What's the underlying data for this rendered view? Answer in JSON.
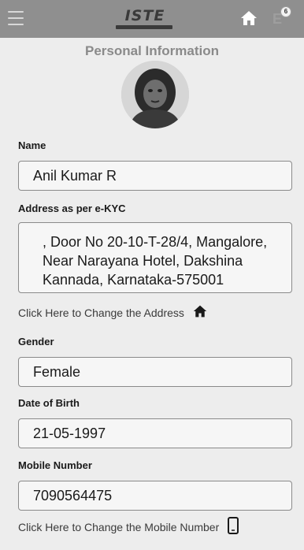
{
  "header": {
    "logo_text": "ISTE",
    "lang_text": "E",
    "lang_badge": "6"
  },
  "page": {
    "title": "Personal Information"
  },
  "profile": {
    "name_label": "Name",
    "name_value": "Anil Kumar R",
    "address_label": "Address as per e-KYC",
    "address_value": ", Door No 20-10-T-28/4, Mangalore, Near Narayana Hotel, Dakshina Kannada, Karnataka-575001",
    "change_address_link": "Click Here to Change the Address",
    "gender_label": "Gender",
    "gender_value": "Female",
    "dob_label": "Date of Birth",
    "dob_value": "21-05-1997",
    "mobile_label": "Mobile Number",
    "mobile_value": "7090564475",
    "change_mobile_link": "Click Here to Change the Mobile Number"
  },
  "icons": {
    "menu": "menu-icon",
    "home": "home-icon",
    "lang": "language-icon",
    "phone": "mobile-phone-icon"
  },
  "colors": {
    "appbar": "#8f8f8f",
    "background": "#ededed",
    "title": "#8a8a8a"
  }
}
